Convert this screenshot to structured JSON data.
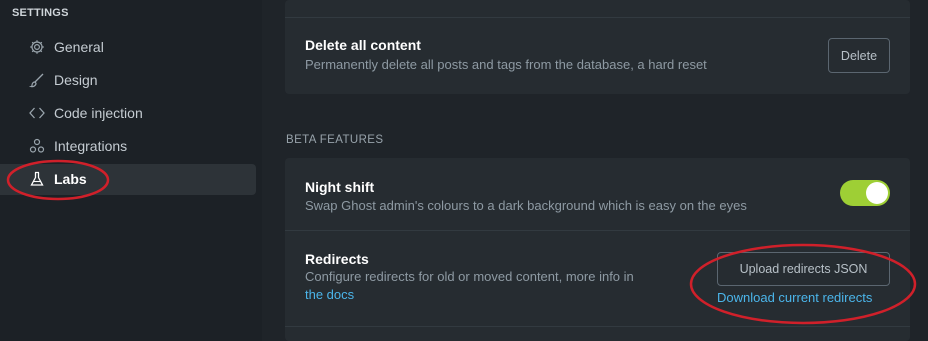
{
  "sidebar": {
    "heading": "SETTINGS",
    "items": [
      {
        "label": "General",
        "icon": "gear-icon"
      },
      {
        "label": "Design",
        "icon": "brush-icon"
      },
      {
        "label": "Code injection",
        "icon": "code-icon"
      },
      {
        "label": "Integrations",
        "icon": "integrations-icon"
      },
      {
        "label": "Labs",
        "icon": "flask-icon",
        "active": true
      }
    ]
  },
  "main": {
    "delete_content": {
      "title": "Delete all content",
      "description": "Permanently delete all posts and tags from the database, a hard reset",
      "button_label": "Delete"
    },
    "beta_heading": "BETA FEATURES",
    "night_shift": {
      "title": "Night shift",
      "description": "Swap Ghost admin's colours to a dark background which is easy on the eyes",
      "enabled": true
    },
    "redirects": {
      "title": "Redirects",
      "description_line1": "Configure redirects for old or moved content, more info in",
      "docs_link": "the docs",
      "upload_button": "Upload redirects JSON",
      "download_link": "Download current redirects"
    }
  },
  "colors": {
    "background": "#1e2328",
    "card": "#262c31",
    "accent_link": "#4bb5ea",
    "toggle_on": "#9ecf35",
    "annotation": "#d0202a"
  }
}
